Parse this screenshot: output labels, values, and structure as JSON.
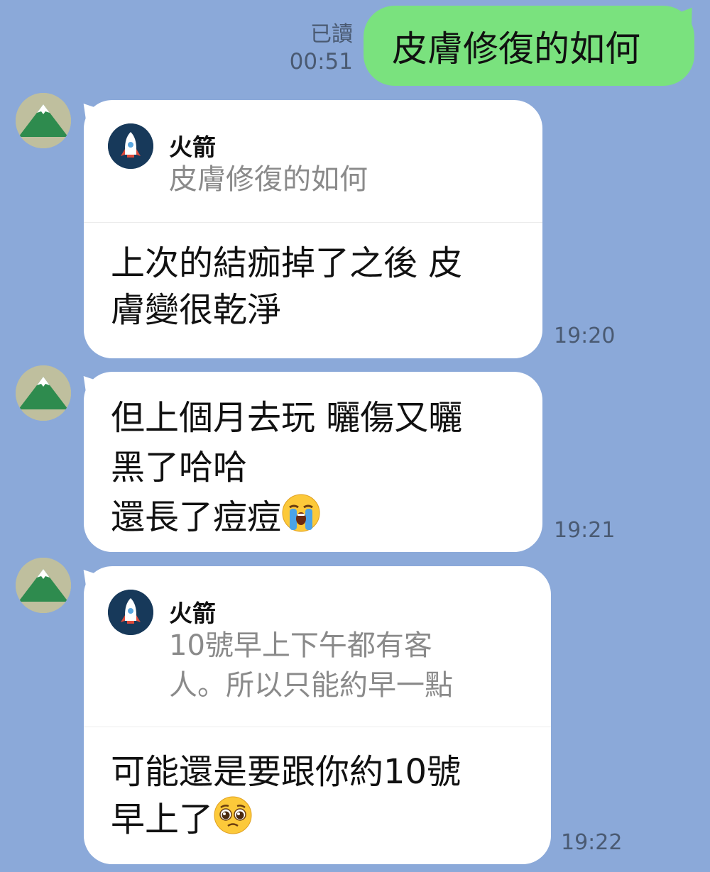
{
  "outgoing": {
    "read_label": "已讀",
    "time": "00:51",
    "text": "皮膚修復的如何"
  },
  "messages": [
    {
      "reply": {
        "name": "火箭",
        "text": "皮膚修復的如何"
      },
      "lines": [
        "上次的結痂掉了之後 皮",
        "膚變很乾淨"
      ],
      "time": "19:20"
    },
    {
      "lines": [
        "但上個月去玩 曬傷又曬",
        "黑了哈哈",
        "還長了痘痘"
      ],
      "emoji": "loudly-crying-face",
      "time": "19:21"
    },
    {
      "reply": {
        "name": "火箭",
        "lines": [
          "10號早上下午都有客",
          "人。所以只能約早一點"
        ]
      },
      "lines": [
        "可能還是要跟你約10號",
        "早上了"
      ],
      "emoji": "pleading-face",
      "time": "19:22"
    }
  ],
  "colors": {
    "background": "#8ba9d9",
    "outgoing_bubble": "#7ae27e",
    "incoming_bubble": "#ffffff"
  }
}
